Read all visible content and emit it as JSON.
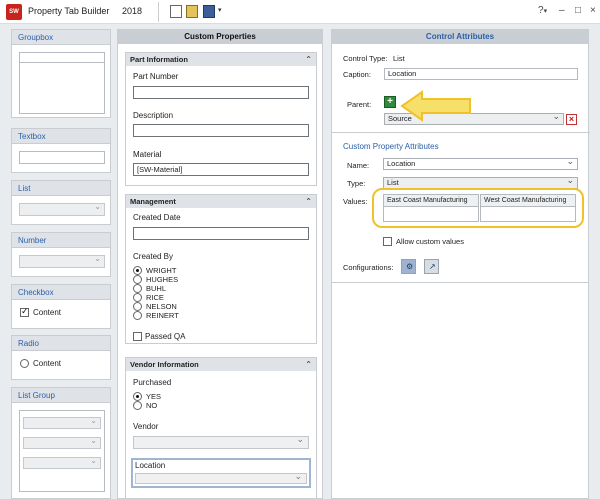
{
  "app": {
    "title": "Property Tab Builder",
    "year": "2018",
    "icon": "solidworks-logo-icon",
    "toolbar": [
      "new-document-icon",
      "open-folder-icon",
      "save-icon",
      "dropdown-arrow-icon"
    ],
    "window_controls": {
      "help": "?",
      "help_dropdown": "▾",
      "minimize": "–",
      "maximize": "□",
      "close": "×"
    },
    "toolbar_dropdown": "▾"
  },
  "palette": {
    "groupbox": "Groupbox",
    "textbox": "Textbox",
    "list": "List",
    "number": "Number",
    "checkbox": "Checkbox",
    "checkbox_content": "Content",
    "radio": "Radio",
    "radio_content": "Content",
    "list_group": "List Group"
  },
  "center": {
    "title": "Custom Properties",
    "collapse_glyph": "⌃",
    "part_info": {
      "title": "Part Information",
      "part_number_label": "Part Number",
      "part_number_value": "",
      "description_label": "Description",
      "description_value": "",
      "material_label": "Material",
      "material_value": "[SW-Material]"
    },
    "management": {
      "title": "Management",
      "created_date_label": "Created Date",
      "created_by_label": "Created By",
      "created_by_options": [
        "WRIGHT",
        "HUGHES",
        "BUHL",
        "RICE",
        "NELSON",
        "REINERT"
      ],
      "created_by_selected": "WRIGHT",
      "passed_qa_label": "Passed QA"
    },
    "vendor": {
      "title": "Vendor Information",
      "purchased_label": "Purchased",
      "purchased_options": [
        "YES",
        "NO"
      ],
      "purchased_selected": "YES",
      "vendor_label": "Vendor",
      "location_label": "Location"
    }
  },
  "right": {
    "title": "Control Attributes",
    "control_type_label": "Control Type:",
    "control_type_value": "List",
    "caption_label": "Caption:",
    "caption_value": "Location",
    "parent_label": "Parent:",
    "parent_add_glyph": "+",
    "parent_remove_glyph": "×",
    "parent_value": "Source",
    "cpa_title": "Custom Property Attributes",
    "name_label": "Name:",
    "name_value": "Location",
    "type_label": "Type:",
    "type_value": "List",
    "values_label": "Values:",
    "values_columns": [
      "East Coast Manufacturing",
      "West Coast Manufacturing"
    ],
    "allow_custom_label": "Allow custom values",
    "configurations_label": "Configurations:",
    "config_glyphs": [
      "⚙",
      "↗"
    ]
  },
  "colors": {
    "accent_blue": "#2a5fa8",
    "highlight_yellow": "#f0c12a",
    "add_green": "#2f8b3a",
    "remove_red": "#d11111"
  }
}
